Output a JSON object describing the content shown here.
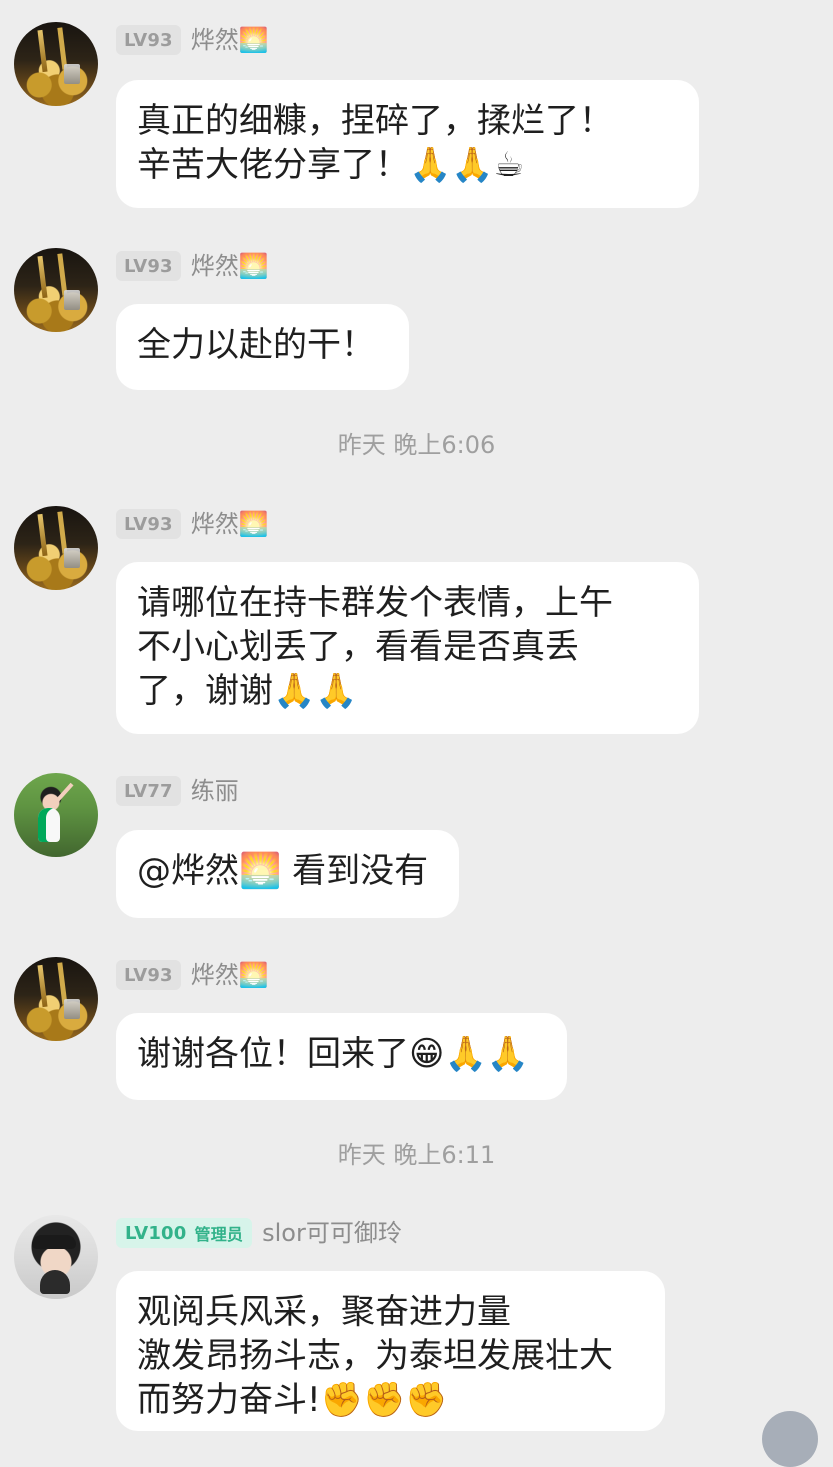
{
  "chat": {
    "messages": [
      {
        "level": "LV93",
        "name": "烨然🌅",
        "text": "真正的细糠，捏碎了，揉烂了！\n辛苦大佬分享了！🙏🙏☕"
      },
      {
        "level": "LV93",
        "name": "烨然🌅",
        "text": "全力以赴的干！"
      },
      {
        "level": "LV93",
        "name": "烨然🌅",
        "text": "请哪位在持卡群发个表情，上午\n不小心划丢了，看看是否真丢\n了，谢谢🙏🙏"
      },
      {
        "level": "LV77",
        "name": "练丽",
        "text": "@烨然🌅 看到没有"
      },
      {
        "level": "LV93",
        "name": "烨然🌅",
        "text": "谢谢各位！回来了😁🙏🙏"
      },
      {
        "level": "LV100",
        "role": "管理员",
        "name": "slor可可御玲",
        "text": "观阅兵风采，聚奋进力量\n激发昂扬斗志，为泰坦发展壮大\n而努力奋斗!✊✊✊"
      }
    ],
    "timestamps": [
      "昨天 晚上6:06",
      "昨天 晚上6:11"
    ]
  },
  "icons": {
    "avatar_gold": "gold-ingot-avatar",
    "avatar_green": "person-green-background-avatar",
    "avatar_portrait": "woman-portrait-avatar",
    "corner_button": "scroll-button"
  }
}
